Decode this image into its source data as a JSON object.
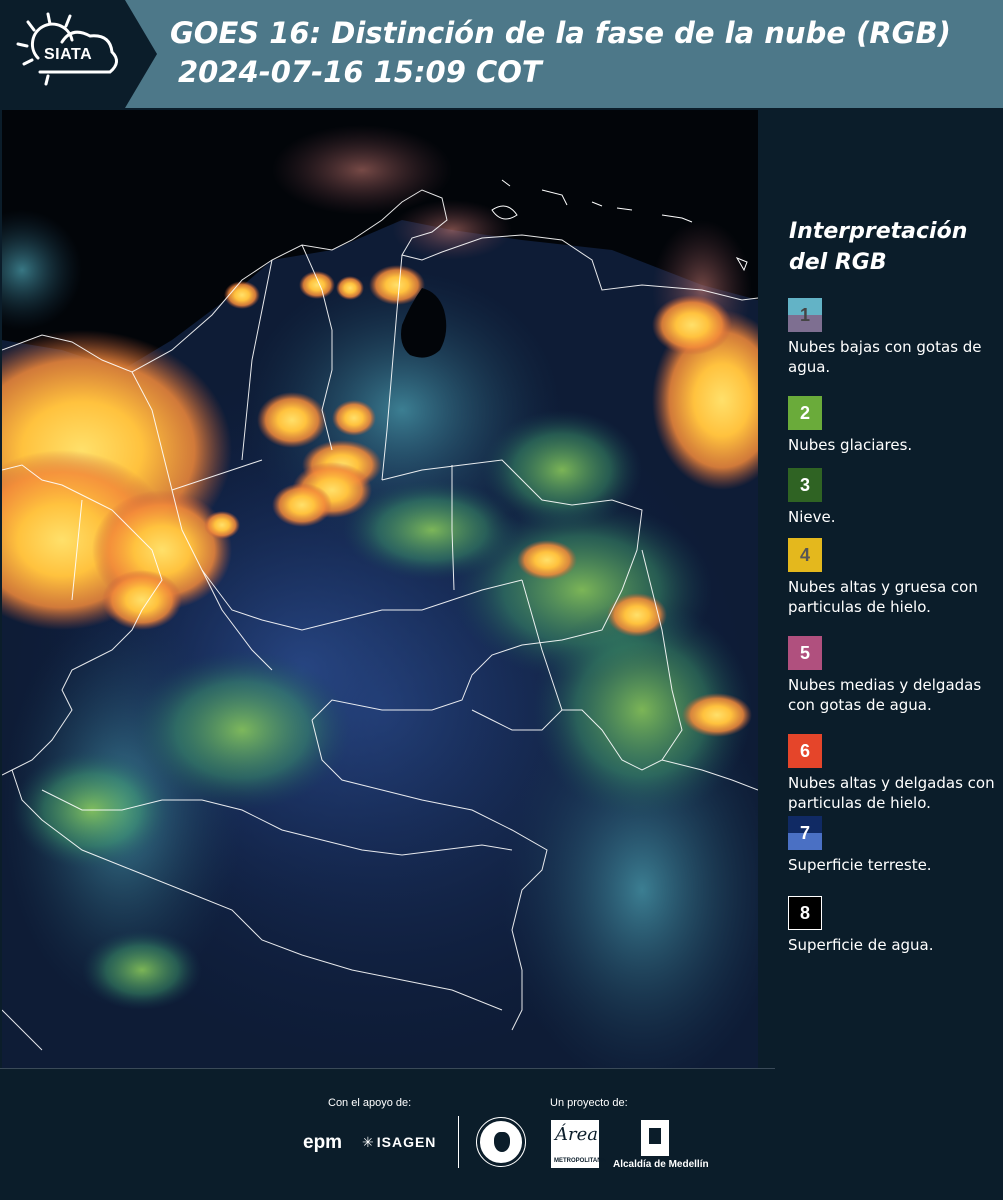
{
  "header": {
    "logo_text": "SIATA",
    "title_line1": "GOES 16: Distinción de la fase de la nube (RGB)",
    "title_line2": "2024-07-16 15:09 COT",
    "bg_color": "#4d7889"
  },
  "legend": {
    "title_line1": "Interpretación",
    "title_line2": "del RGB",
    "items": [
      {
        "number": "1",
        "label": "Nubes bajas con gotas de agua.",
        "colors": [
          "#63b3c6",
          "#7e6f91"
        ],
        "num_color": "#444444"
      },
      {
        "number": "2",
        "label": "Nubes glaciares.",
        "colors": [
          "#6aab3a"
        ],
        "num_color": "#ffffff"
      },
      {
        "number": "3",
        "label": "Nieve.",
        "colors": [
          "#2f6323"
        ],
        "num_color": "#ffffff"
      },
      {
        "number": "4",
        "label": "Nubes altas y gruesa con particulas de hielo.",
        "colors": [
          "#e4b81d"
        ],
        "num_color": "#555555"
      },
      {
        "number": "5",
        "label": "Nubes medias y delgadas con gotas de agua.",
        "colors": [
          "#b0507e"
        ],
        "num_color": "#ffffff"
      },
      {
        "number": "6",
        "label": "Nubes altas y delgadas con particulas de hielo.",
        "colors": [
          "#e5452a"
        ],
        "num_color": "#ffffff"
      },
      {
        "number": "7",
        "label": "Superficie terreste.",
        "colors": [
          "#102a64",
          "#4a70c4"
        ],
        "num_color": "#ffffff"
      },
      {
        "number": "8",
        "label": "Superficie de agua.",
        "colors": [
          "#000000"
        ],
        "num_color": "#ffffff"
      }
    ]
  },
  "footer": {
    "support_label": "Con el apoyo de:",
    "project_label": "Un proyecto de:",
    "epm": "epm",
    "isagen": "ISAGEN",
    "area_logo_text": "Área",
    "area_logo_sub": "METROPOLITANA",
    "alcaldia": "Alcaldía de Medellín"
  }
}
